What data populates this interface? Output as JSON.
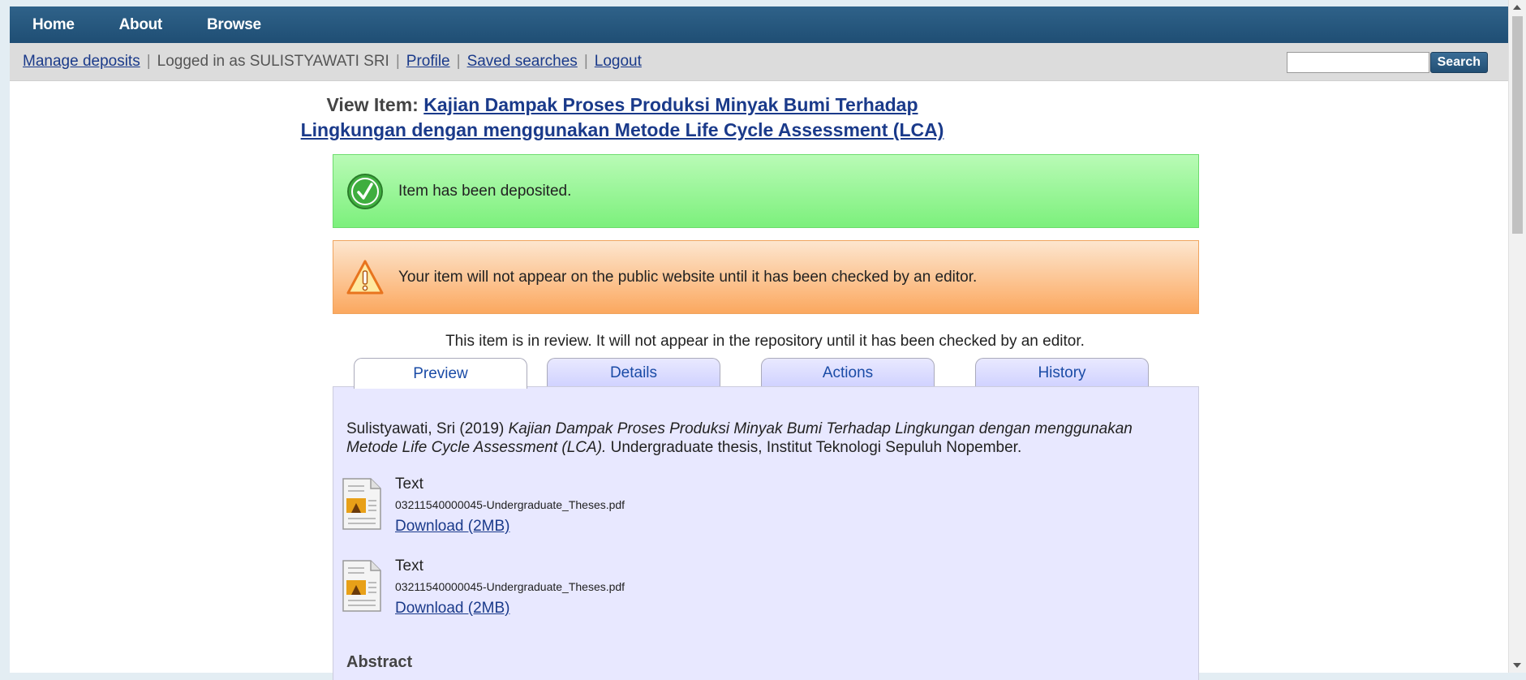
{
  "topnav": {
    "items": [
      "Home",
      "About",
      "Browse"
    ]
  },
  "userbar": {
    "manage_deposits": "Manage deposits",
    "logged_in_text": "Logged in as SULISTYAWATI SRI",
    "profile": "Profile",
    "saved_searches": "Saved searches",
    "logout": "Logout",
    "search_value": "",
    "search_button": "Search"
  },
  "title": {
    "prefix": "View Item:",
    "link": "Kajian Dampak Proses Produksi Minyak Bumi Terhadap Lingkungan dengan menggunakan Metode Life Cycle Assessment (LCA)"
  },
  "messages": {
    "success": "Item has been deposited.",
    "warning": "Your item will not appear on the public website until it has been checked by an editor."
  },
  "review_notice": "This item is in review. It will not appear in the repository until it has been checked by an editor.",
  "tabs": [
    "Preview",
    "Details",
    "Actions",
    "History"
  ],
  "citation": {
    "authors_year": "Sulistyawati, Sri (2019)",
    "title_italic": "Kajian Dampak Proses Produksi Minyak Bumi Terhadap Lingkungan dengan menggunakan Metode Life Cycle Assessment (LCA).",
    "rest": "Undergraduate thesis, Institut Teknologi Sepuluh Nopember."
  },
  "documents": [
    {
      "type": "Text",
      "filename": "03211540000045-Undergraduate_Theses.pdf",
      "download": "Download (2MB)"
    },
    {
      "type": "Text",
      "filename": "03211540000045-Undergraduate_Theses.pdf",
      "download": "Download (2MB)"
    }
  ],
  "abstract_heading": "Abstract",
  "colors": {
    "nav_bg": "#1f4e74",
    "success_bg": "#7cf07c",
    "warning_bg": "#fba85f",
    "panel_bg": "#e8e8ff",
    "link": "#1a3a8a"
  }
}
